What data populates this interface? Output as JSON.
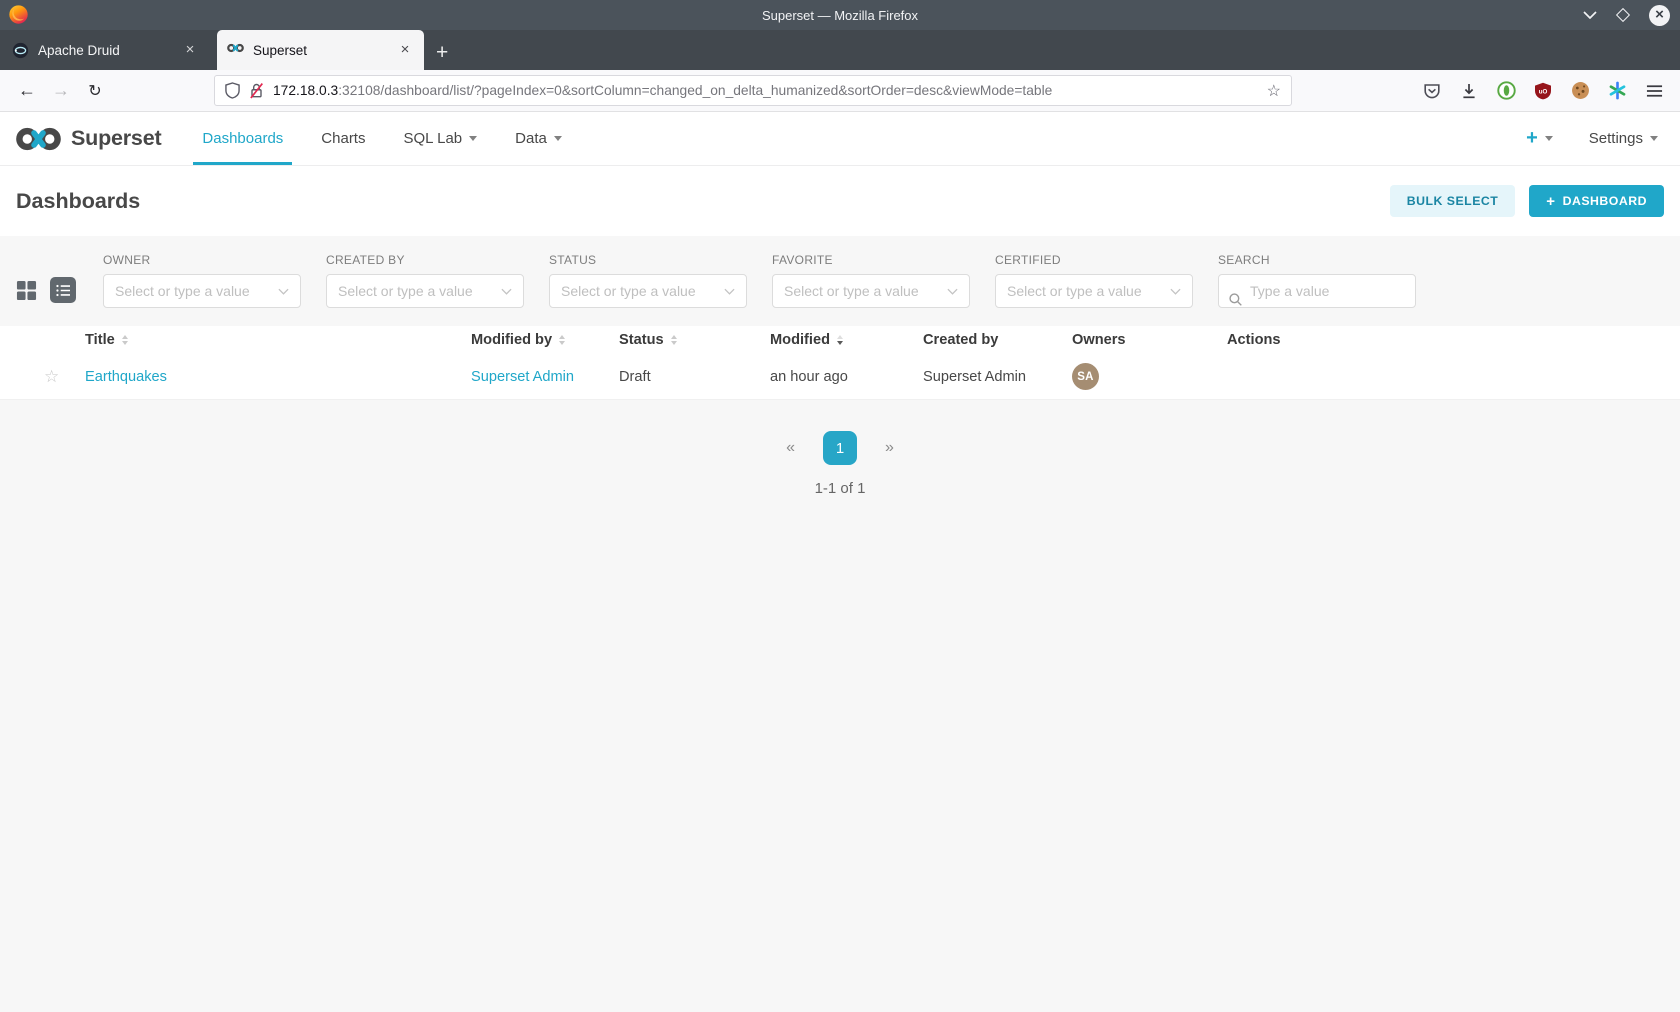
{
  "browser": {
    "window_title": "Superset — Mozilla Firefox",
    "tabs": [
      {
        "label": "Apache Druid"
      },
      {
        "label": "Superset"
      }
    ],
    "close_tab_glyph": "×",
    "new_tab_glyph": "+",
    "toolbar": {
      "back_glyph": "←",
      "forward_glyph": "→",
      "reload_glyph": "↻",
      "bookmark_glyph": "☆"
    },
    "url": {
      "host": "172.18.0.3",
      "path": ":32108/dashboard/list/?pageIndex=0&sortColumn=changed_on_delta_humanized&sortOrder=desc&viewMode=table"
    }
  },
  "app_nav": {
    "brand": "Superset",
    "items": [
      {
        "label": "Dashboards"
      },
      {
        "label": "Charts"
      },
      {
        "label": "SQL Lab"
      },
      {
        "label": "Data"
      }
    ],
    "plus_label": "+",
    "settings_label": "Settings"
  },
  "page": {
    "title": "Dashboards",
    "bulk_select_label": "BULK SELECT",
    "new_dashboard": {
      "plus": "+",
      "label": "DASHBOARD"
    }
  },
  "filters": {
    "owner": {
      "label": "OWNER",
      "placeholder": "Select or type a value"
    },
    "created_by": {
      "label": "CREATED BY",
      "placeholder": "Select or type a value"
    },
    "status": {
      "label": "STATUS",
      "placeholder": "Select or type a value"
    },
    "favorite": {
      "label": "FAVORITE",
      "placeholder": "Select or type a value"
    },
    "certified": {
      "label": "CERTIFIED",
      "placeholder": "Select or type a value"
    },
    "search": {
      "label": "SEARCH",
      "placeholder": "Type a value"
    }
  },
  "table": {
    "columns": {
      "title": "Title",
      "modified_by": "Modified by",
      "status": "Status",
      "modified": "Modified",
      "created_by": "Created by",
      "owners": "Owners",
      "actions": "Actions"
    },
    "rows": [
      {
        "favorite_glyph": "☆",
        "title": "Earthquakes",
        "modified_by": "Superset Admin",
        "status": "Draft",
        "modified": "an hour ago",
        "created_by": "Superset Admin",
        "owner_initials": "SA"
      }
    ]
  },
  "pagination": {
    "prev": "«",
    "page": "1",
    "next": "»",
    "summary": "1-1 of 1"
  },
  "colors": {
    "accent": "#20a7c9",
    "link": "#20a7c9",
    "avatar_bg": "#a58d72",
    "titlebar_bg": "#4b535b",
    "tabbar_bg": "#42484e",
    "content_bg": "#f7f7f7",
    "bulk_button_bg": "#e5f5fa",
    "bulk_button_text": "#1a85a3",
    "insecure_slash": "#e22850",
    "active_page_bg": "#27a6c7"
  }
}
